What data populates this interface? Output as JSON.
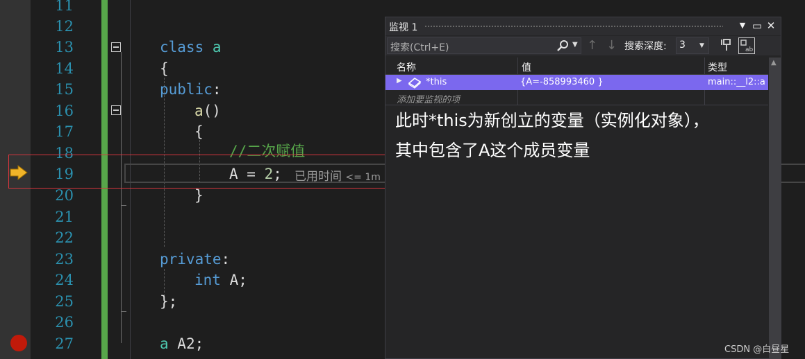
{
  "editor": {
    "line_numbers": [
      "11",
      "12",
      "13",
      "14",
      "15",
      "16",
      "17",
      "18",
      "19",
      "20",
      "21",
      "22",
      "23",
      "24",
      "25",
      "26",
      "27"
    ],
    "code": {
      "l13_kw": "class",
      "l13_name": "a",
      "l14": "{",
      "l15_kw": "public",
      "l15_punct": ":",
      "l16_fn": "a",
      "l16_punct": "()",
      "l17": "{",
      "l18_comment": "//二次赋值",
      "l19_var": "A",
      "l19_op": " = ",
      "l19_num": "2",
      "l19_end": ";",
      "l20": "}",
      "l23_kw": "private",
      "l23_punct": ":",
      "l24_kw": "int",
      "l24_rest": " A;",
      "l25": "};",
      "l27_type": "a",
      "l27_rest": " A2;"
    },
    "elapsed_hint": "已用时间",
    "elapsed_value": "<= 1m",
    "current_line": "19",
    "breakpoint_line": "27"
  },
  "watch": {
    "title": "监视 1",
    "search_placeholder": "搜索(Ctrl+E)",
    "depth_label": "搜索深度:",
    "depth_value": "3",
    "columns": [
      "名称",
      "值",
      "类型"
    ],
    "rows": [
      {
        "name": "*this",
        "value": "{A=-858993460 }",
        "type": "main::__l2::a"
      }
    ],
    "add_watch_placeholder": "添加要监视的项",
    "annotation_line1": "此时*this为新创立的变量（实例化对象），",
    "annotation_line2": "其中包含了A这个成员变量"
  },
  "watermark": "CSDN @白昼星",
  "colors": {
    "selected_row": "#7b68ee",
    "change_bar": "#57a64a",
    "keyword": "#569cd6",
    "comment": "#57a64a",
    "highlight_box": "#d9363e"
  },
  "icons": [
    "execution-arrow-icon",
    "breakpoint-icon",
    "collapse-icon",
    "search-icon",
    "pin-icon",
    "hex-display-icon",
    "object-icon"
  ]
}
